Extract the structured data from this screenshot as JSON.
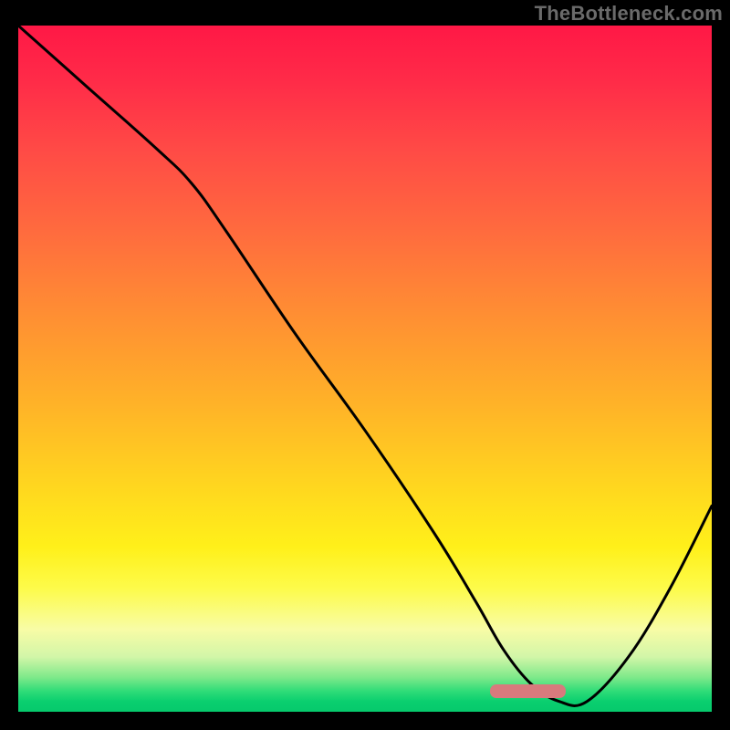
{
  "watermark": "TheBottleneck.com",
  "colors": {
    "frame_bg": "#000000",
    "curve_stroke": "#000000",
    "marker_fill": "#d87a7d",
    "gradient_top": "#ff1846",
    "gradient_bottom": "#06c96c"
  },
  "marker": {
    "x_start_pct": 68,
    "x_end_pct": 79,
    "y_pct": 97
  },
  "chart_data": {
    "type": "line",
    "title": "",
    "xlabel": "",
    "ylabel": "",
    "xlim": [
      0,
      100
    ],
    "ylim": [
      0,
      100
    ],
    "x": [
      0,
      10,
      20,
      25,
      30,
      40,
      50,
      60,
      66,
      70,
      74,
      78,
      82,
      88,
      94,
      100
    ],
    "y": [
      100,
      91,
      82,
      77,
      70,
      55,
      41,
      26,
      16,
      9,
      4,
      1.5,
      1.5,
      8,
      18,
      30
    ],
    "series": [
      {
        "name": "bottleneck-curve",
        "x": [
          0,
          10,
          20,
          25,
          30,
          40,
          50,
          60,
          66,
          70,
          74,
          78,
          82,
          88,
          94,
          100
        ],
        "y": [
          100,
          91,
          82,
          77,
          70,
          55,
          41,
          26,
          16,
          9,
          4,
          1.5,
          1.5,
          8,
          18,
          30
        ]
      }
    ],
    "marker_range_x": [
      68,
      79
    ],
    "annotations": []
  }
}
